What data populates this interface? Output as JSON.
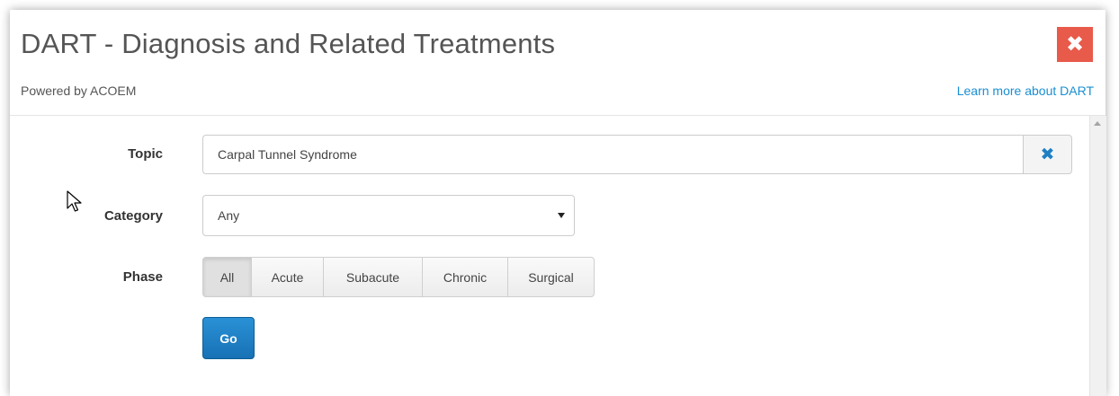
{
  "header": {
    "title": "DART - Diagnosis and Related Treatments",
    "subtitle": "Powered by ACOEM",
    "learn_more": "Learn more about DART",
    "close_icon": "close-icon",
    "close_glyph": "✖"
  },
  "form": {
    "topic": {
      "label": "Topic",
      "value": "Carpal Tunnel Syndrome",
      "clear_glyph": "✖"
    },
    "category": {
      "label": "Category",
      "selected": "Any"
    },
    "phase": {
      "label": "Phase",
      "options": [
        "All",
        "Acute",
        "Subacute",
        "Chronic",
        "Surgical"
      ],
      "selected": "All"
    },
    "go_label": "Go"
  },
  "colors": {
    "close_bg": "#e85a4a",
    "link": "#1a8fd1",
    "go_bg": "#1f7fc4"
  }
}
